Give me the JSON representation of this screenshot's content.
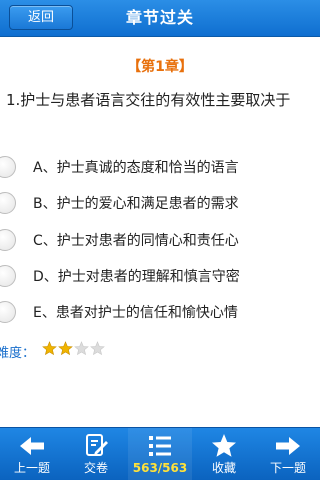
{
  "header": {
    "back_label": "返回",
    "title": "章节过关"
  },
  "question": {
    "chapter": "【第1章】",
    "text": "1.护士与患者语言交往的有效性主要取决于",
    "options": [
      {
        "label": "A、护士真诚的态度和恰当的语言"
      },
      {
        "label": "B、护士的爱心和满足患者的需求"
      },
      {
        "label": "C、护士对患者的同情心和责任心"
      },
      {
        "label": "D、护士对患者的理解和慎言守密"
      },
      {
        "label": "E、患者对护士的信任和愉快心情"
      }
    ]
  },
  "difficulty": {
    "label": "难度：",
    "rating": 2,
    "max": 4,
    "star_color": "#f0b400",
    "empty_star_color": "#dcdcdc"
  },
  "toolbar": {
    "items": [
      {
        "label": "上一题",
        "icon": "arrow-left-icon"
      },
      {
        "label": "交卷",
        "icon": "submit-paper-icon"
      },
      {
        "label": "563/563",
        "icon": "list-icon"
      },
      {
        "label": "收藏",
        "icon": "star-icon"
      },
      {
        "label": "下一题",
        "icon": "arrow-right-icon"
      }
    ]
  },
  "colors": {
    "accent": "#0f6fd0",
    "chapter": "#e8700c",
    "counter": "#ffe23a"
  }
}
